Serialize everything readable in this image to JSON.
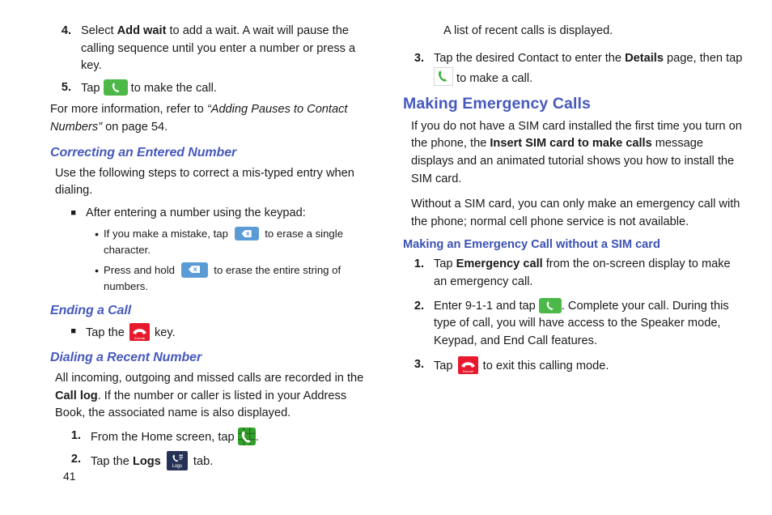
{
  "page": {
    "number": "41",
    "heading_color": "#4659bd",
    "accent_green": "#4cb848",
    "accent_blue_key": "#5b9bd5",
    "accent_red": "#e8192c",
    "accent_navy": "#263255"
  },
  "left_column": {
    "step4": {
      "marker": "4.",
      "part1": "Select ",
      "bold1": "Add wait",
      "part2": " to add a wait. A wait will pause the calling sequence until you enter a number or press a key."
    },
    "step5": {
      "marker": "5.",
      "part1": "Tap ",
      "icon": "green-call-button-icon",
      "part2": " to make the call."
    },
    "note": {
      "part1": "For more information, refer to ",
      "italic": "“Adding Pauses to Contact Numbers”",
      "part2": " on page 54."
    },
    "heading_correcting": "Correcting an Entered Number",
    "correcting_intro": "Use the following steps to correct a mis-typed entry when dialing.",
    "bullet_keypad": {
      "marker": "■",
      "text": "After entering a number using the keypad:"
    },
    "sub_bullet_1": {
      "marker": "•",
      "part1": "If you make a mistake, tap ",
      "icon": "backspace-key-icon",
      "part2": " to erase a single character."
    },
    "sub_bullet_2": {
      "marker": "•",
      "part1": "Press and hold ",
      "icon": "backspace-key-icon",
      "part2": " to erase the entire string of numbers."
    },
    "heading_ending": "Ending a Call",
    "bullet_end": {
      "marker": "■",
      "part1": "Tap the ",
      "icon": "end-call-key-icon",
      "icon_label": "End call",
      "part2": " key."
    },
    "heading_dialing_recent": "Dialing a Recent Number",
    "recent_intro": {
      "part1": "All incoming, outgoing and missed calls are recorded in the ",
      "bold1": "Call log",
      "part2": ". If the number or caller is listed in your Address Book, the associated name is also displayed."
    },
    "step1": {
      "marker": "1.",
      "part1": "From the Home screen, tap ",
      "icon": "phone-keypad-app-icon",
      "part2": "."
    },
    "step2": {
      "marker": "2.",
      "part1": "Tap the ",
      "bold1": "Logs",
      "part2": " ",
      "icon": "logs-tab-icon",
      "icon_label": "Logs",
      "part3": " tab."
    }
  },
  "right_column": {
    "continuation": "A list of recent calls is displayed.",
    "step3": {
      "marker": "3.",
      "part1": "Tap the desired Contact to enter the ",
      "bold1": "Details",
      "part2": " page, then tap ",
      "icon": "green-handset-icon",
      "part3": " to make a call."
    },
    "heading_emergency": "Making Emergency Calls",
    "para_sim": {
      "part1": "If you do not have a SIM card installed the first time you turn on the phone, the ",
      "bold1": "Insert SIM card to make calls",
      "part2": " message displays and an animated tutorial shows you how to install the SIM card."
    },
    "para_without_sim": "Without a SIM card, you can only make an emergency call with the phone; normal cell phone service is not available.",
    "heading_emergency_no_sim": "Making an Emergency Call without a SIM card",
    "step1": {
      "marker": "1.",
      "part1": "Tap ",
      "bold1": "Emergency call",
      "part2": " from the on-screen display to make an emergency call."
    },
    "step2": {
      "marker": "2.",
      "part1": "Enter 9-1-1 and tap ",
      "icon": "green-call-button-icon",
      "part2": ". Complete your call. During this type of call, you will have access to the Speaker mode, Keypad, and End Call features."
    },
    "step3b": {
      "marker": "3.",
      "part1": "Tap ",
      "icon": "end-call-key-icon",
      "icon_label": "End call",
      "part2": " to exit this calling mode."
    }
  }
}
